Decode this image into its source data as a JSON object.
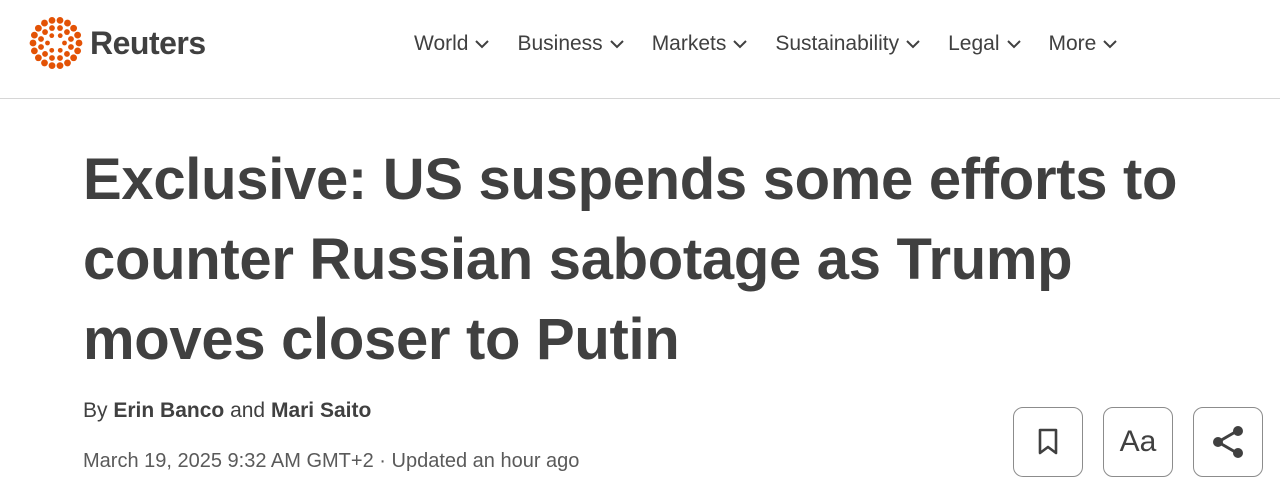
{
  "header": {
    "logo_text": "Reuters",
    "brand_color": "#e35205",
    "nav": [
      {
        "label": "World"
      },
      {
        "label": "Business"
      },
      {
        "label": "Markets"
      },
      {
        "label": "Sustainability"
      },
      {
        "label": "Legal"
      },
      {
        "label": "More"
      }
    ]
  },
  "article": {
    "headline": "Exclusive: US suspends some efforts to counter Russian sabotage as Trump moves closer to Putin",
    "byline_prefix": "By",
    "authors": [
      "Erin Banco",
      "Mari Saito"
    ],
    "byline_join": "and",
    "date": "March 19, 2025 9:32 AM GMT+2",
    "separator": "·",
    "updated": "Updated an hour ago"
  },
  "tools": {
    "bookmark_icon": "bookmark-icon",
    "text_size_label": "Aa",
    "share_icon": "share-icon"
  }
}
